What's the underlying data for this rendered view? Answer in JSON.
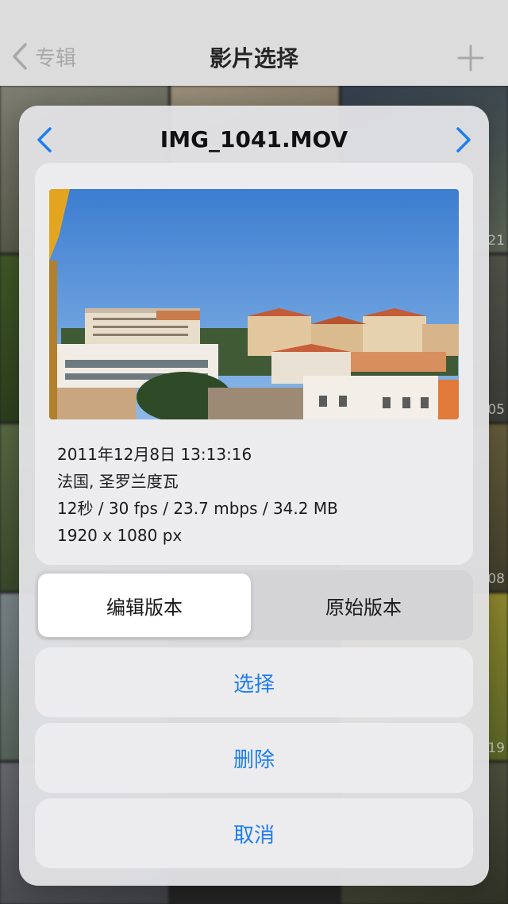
{
  "nav": {
    "back_label": "专辑",
    "title": "影片选择"
  },
  "background": {
    "tile_labels": [
      "21",
      "05",
      "08",
      "19"
    ]
  },
  "dialog": {
    "title": "IMG_1041.MOV",
    "metadata": {
      "datetime": "2011年12月8日 13:13:16",
      "location": "法国, 圣罗兰度瓦",
      "stats": "12秒 / 30 fps / 23.7 mbps / 34.2 MB",
      "resolution": "1920 x 1080 px"
    },
    "version_toggle": {
      "options": [
        "编辑版本",
        "原始版本"
      ],
      "selected": "编辑版本"
    },
    "actions": {
      "select": "选择",
      "delete": "删除",
      "cancel": "取消"
    }
  },
  "colors": {
    "accent": "#1e7df0",
    "nav_bg": "#dcdcdc",
    "dialog_bg": "#e2e2e5"
  }
}
